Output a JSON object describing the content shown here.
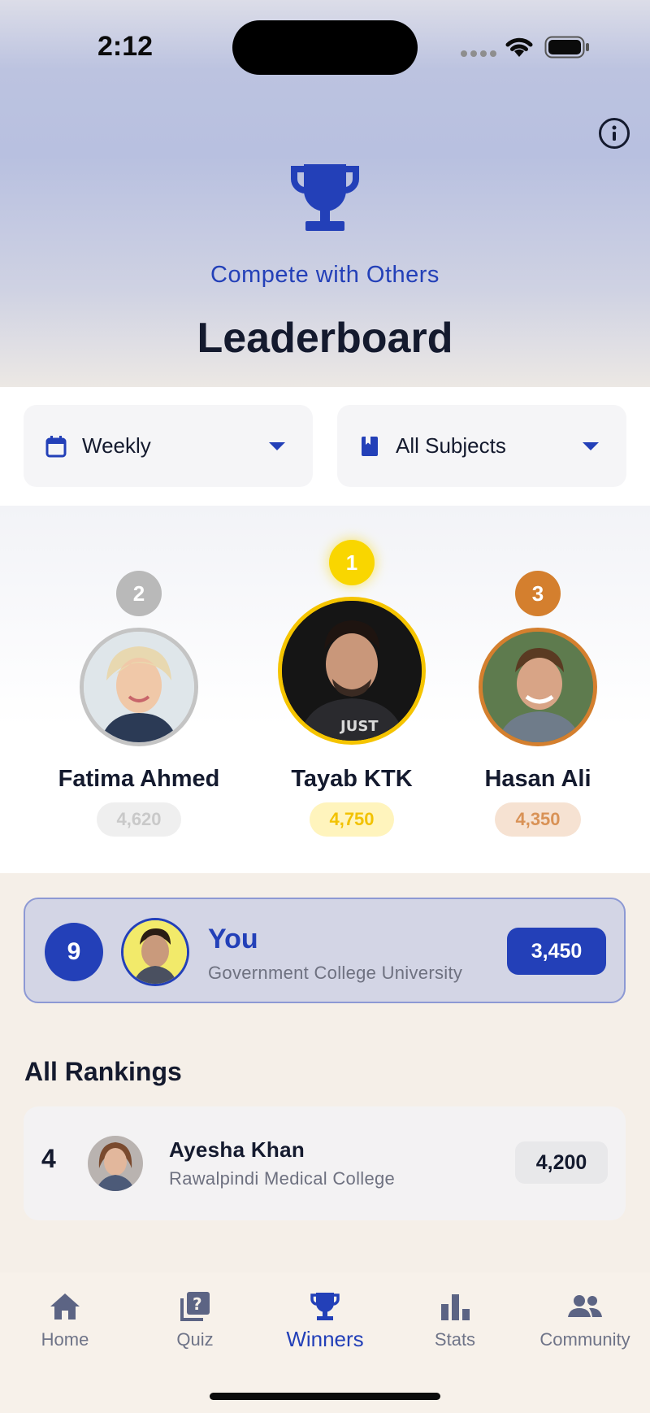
{
  "status": {
    "time": "2:12"
  },
  "header": {
    "subtitle": "Compete with Others",
    "title": "Leaderboard"
  },
  "filters": {
    "period": {
      "value": "Weekly",
      "icon": "calendar-icon"
    },
    "subject": {
      "value": "All Subjects",
      "icon": "book-icon"
    }
  },
  "podium": {
    "first": {
      "rank": "1",
      "name": "Tayab KTK",
      "score": "4,750"
    },
    "second": {
      "rank": "2",
      "name": "Fatima Ahmed",
      "score": "4,620"
    },
    "third": {
      "rank": "3",
      "name": "Hasan Ali",
      "score": "4,350"
    }
  },
  "current_user": {
    "rank": "9",
    "name": "You",
    "college": "Government College University",
    "score": "3,450"
  },
  "rankings": {
    "title": "All Rankings",
    "rows": [
      {
        "rank": "4",
        "name": "Ayesha Khan",
        "college": "Rawalpindi Medical College",
        "score": "4,200"
      }
    ]
  },
  "tabs": [
    {
      "label": "Home",
      "icon": "home-icon"
    },
    {
      "label": "Quiz",
      "icon": "quiz-icon"
    },
    {
      "label": "Winners",
      "icon": "trophy-icon"
    },
    {
      "label": "Stats",
      "icon": "bar-chart-icon"
    },
    {
      "label": "Community",
      "icon": "people-icon"
    }
  ],
  "colors": {
    "accent": "#2340b8",
    "gold": "#f5c400",
    "silver": "#b8b8b8",
    "bronze": "#d47f2e"
  }
}
